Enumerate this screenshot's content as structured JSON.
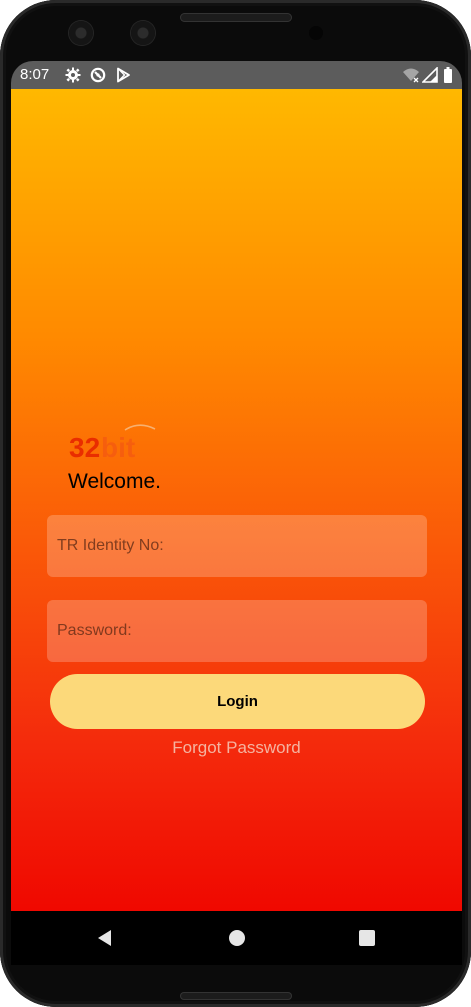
{
  "status_bar": {
    "time": "8:07",
    "icons": [
      "gear-icon",
      "vpn-icon",
      "play-store-icon",
      "wifi-icon",
      "signal-icon",
      "battery-icon"
    ]
  },
  "app": {
    "logo_text": "32bit",
    "welcome": "Welcome.",
    "identity_field": {
      "placeholder": "TR Identity No:",
      "value": ""
    },
    "password_field": {
      "placeholder": "Password:",
      "value": ""
    },
    "login_label": "Login",
    "forgot_password_label": "Forgot Password"
  },
  "navigation": {
    "buttons": [
      "back-icon",
      "home-icon",
      "recents-icon"
    ]
  },
  "colors": {
    "gradient_top": "#ffb800",
    "gradient_bottom": "#f00800",
    "login_button": "#fcd97a",
    "logo_red": "#e62200",
    "status_bar": "#5c5c5c"
  }
}
